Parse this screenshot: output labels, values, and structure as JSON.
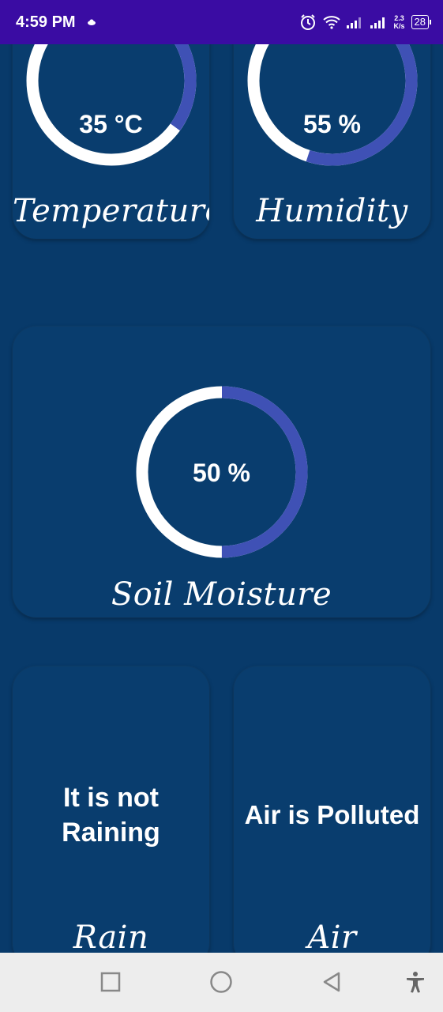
{
  "status_bar": {
    "time": "4:59 PM",
    "net_speed_value": "2.3",
    "net_speed_unit": "K/s",
    "battery": "28"
  },
  "cards": {
    "temperature": {
      "value": "35 °C",
      "label": "Temperature",
      "progress": 0.35
    },
    "humidity": {
      "value": "55 %",
      "label": "Humidity",
      "progress": 0.55
    },
    "soil_moisture": {
      "value": "50 %",
      "label": "Soil Moisture",
      "progress": 0.5
    },
    "rain": {
      "status": [
        "It is not",
        "Raining"
      ],
      "label": "Rain"
    },
    "air": {
      "status": "Air is Polluted",
      "label": "Air"
    }
  },
  "colors": {
    "background": "#083a6a",
    "card": "#093d6e",
    "status_bar": "#3a0ca3",
    "gauge_track": "#ffffff",
    "gauge_fill": "#3f51b5",
    "nav_bar": "#ededed"
  },
  "nav_bar": {
    "icons": [
      "recents-square-icon",
      "home-circle-icon",
      "back-triangle-icon",
      "accessibility-icon"
    ]
  }
}
